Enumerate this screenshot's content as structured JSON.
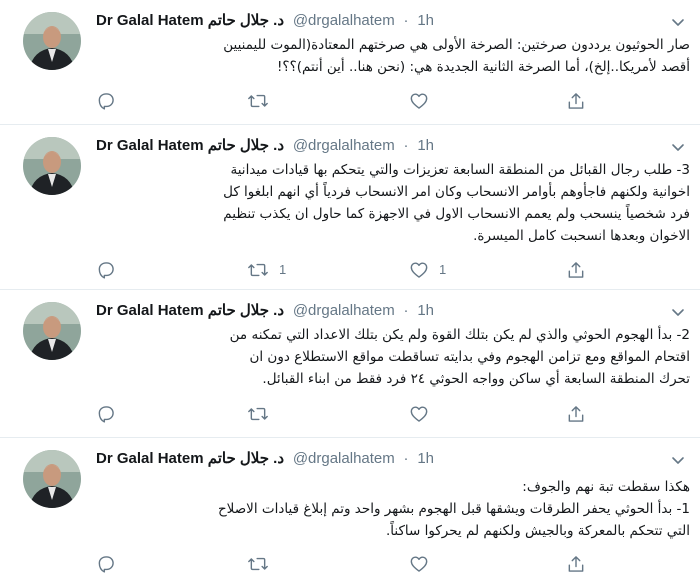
{
  "author": {
    "name": "Dr Galal Hatem د. جلال حاتم",
    "handle": "@drgalalhatem",
    "separator": "·"
  },
  "tweets": [
    {
      "time": "1h",
      "lines": [
        "صار الحوثيون يرددون صرختين: الصرخة الأولى هي صرختهم المعتادة(الموت لليمنيين",
        "أقصد لأمريكا..إلخ)، أما الصرخة الثانية الجديدة هي: (نحن هنا.. أين أنتم)؟؟!"
      ],
      "reply_count": "",
      "retweet_count": "",
      "like_count": ""
    },
    {
      "time": "1h",
      "lines": [
        "3-  طلب رجال القبائل من المنطقة السابعة تعزيزات والتي يتحكم بها قيادات ميدانية",
        "اخوانية ولكنهم فاجأوهم بأوامر الانسحاب وكان امر الانسحاب فردياً أي انهم ابلغوا كل",
        "فرد شخصياً ينسحب ولم يعمم الانسحاب الاول في الاجهزة كما حاول ان يكذب تنظيم",
        "الاخوان وبعدها انسحبت كامل الميسرة."
      ],
      "reply_count": "",
      "retweet_count": "1",
      "like_count": "1"
    },
    {
      "time": "1h",
      "lines": [
        "2- بدأ الهجوم الحوثي والذي لم يكن بتلك القوة ولم يكن بتلك الاعداد التي تمكنه من",
        "اقتحام المواقع ومع تزامن الهجوم وفي بدايته تساقطت مواقع الاستطلاع دون ان",
        "تحرك المنطقة السابعة أي ساكن وواجه الحوثي ٢٤ فرد فقط من ابناء القبائل."
      ],
      "reply_count": "",
      "retweet_count": "",
      "like_count": ""
    },
    {
      "time": "1h",
      "lines": [
        "هكذا سقطت تبة نهم والجوف:",
        "1- بدأ الحوثي يحفر الطرقات ويشقها قبل الهجوم بشهر واحد وتم إبلاغ قيادات الاصلاح",
        "التي تتحكم بالمعركة وبالجيش ولكنهم لم يحركوا ساكناً."
      ],
      "reply_count": "",
      "retweet_count": "",
      "like_count": ""
    }
  ],
  "icons": {
    "reply": "reply-icon",
    "retweet": "retweet-icon",
    "like": "heart-icon",
    "share": "share-icon",
    "caret": "chevron-down-icon",
    "avatar": "avatar"
  },
  "colors": {
    "text": "#14171a",
    "secondary": "#657786",
    "divider": "#e6ecf0",
    "icon": "#657786"
  }
}
